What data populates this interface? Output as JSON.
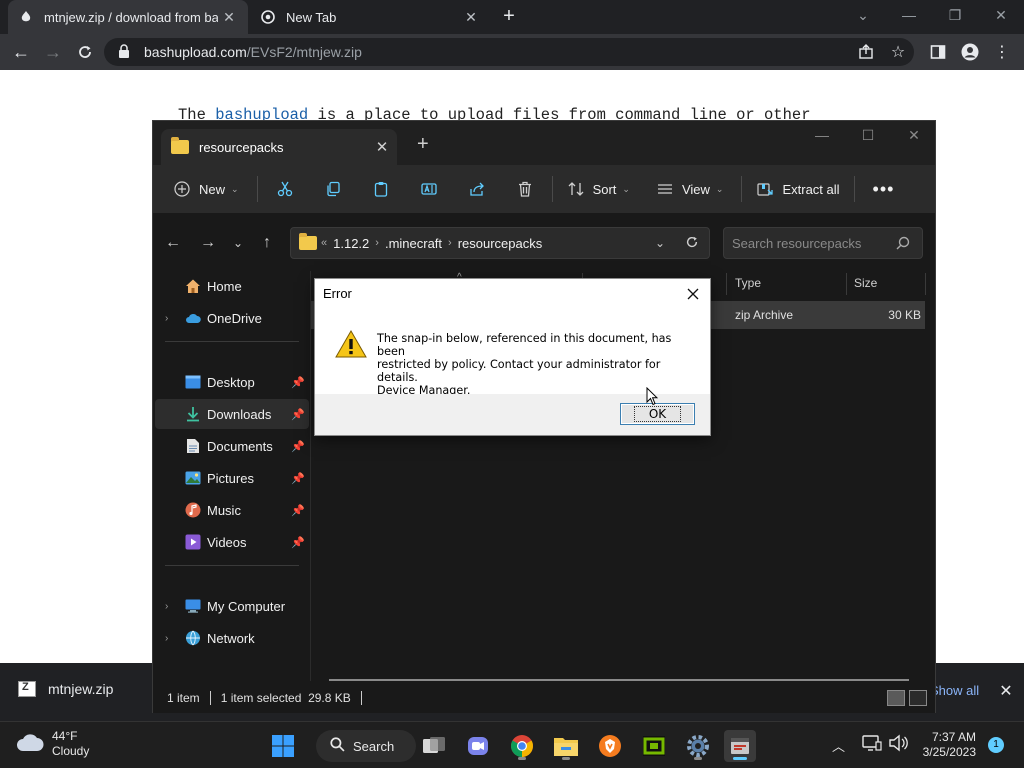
{
  "browser": {
    "tabs": [
      {
        "label": "mtnjew.zip / download from bashupload",
        "active": true
      },
      {
        "label": "New Tab",
        "active": false
      }
    ],
    "url": {
      "host": "bashupload.com",
      "path": "/EVsF2/mtnjew.zip"
    },
    "page": {
      "text_prefix": "The ",
      "link": "bashupload",
      "text_suffix": " is a place to upload files from command line or other"
    },
    "download": {
      "filename": "mtnjew.zip",
      "show_all": "Show all"
    }
  },
  "explorer": {
    "tab_title": "resourcepacks",
    "commands": {
      "new": "New",
      "sort": "Sort",
      "view": "View",
      "extract_all": "Extract all"
    },
    "breadcrumb": [
      "1.12.2",
      ".minecraft",
      "resourcepacks"
    ],
    "search_placeholder": "Search resourcepacks",
    "sidebar": {
      "home": "Home",
      "onedrive": "OneDrive",
      "desktop": "Desktop",
      "downloads": "Downloads",
      "documents": "Documents",
      "pictures": "Pictures",
      "music": "Music",
      "videos": "Videos",
      "my_computer": "My Computer",
      "network": "Network"
    },
    "columns": {
      "type": "Type",
      "size": "Size"
    },
    "file": {
      "type": "zip Archive",
      "size": "30 KB"
    },
    "status": {
      "items": "1 item",
      "selected": "1 item selected  29.8 KB"
    }
  },
  "dialog": {
    "title": "Error",
    "message_line1": "The snap-in below, referenced in this document, has been",
    "message_line2": "restricted by policy. Contact your administrator for details.",
    "message_line3": "Device Manager.",
    "ok": "OK"
  },
  "taskbar": {
    "weather_temp": "44°F",
    "weather_desc": "Cloudy",
    "search": "Search",
    "time": "7:37 AM",
    "date": "3/25/2023",
    "notifications": "1"
  },
  "colors": {
    "accent": "#60cdff",
    "folder": "#f2c94c",
    "link": "#1a5fa8"
  }
}
